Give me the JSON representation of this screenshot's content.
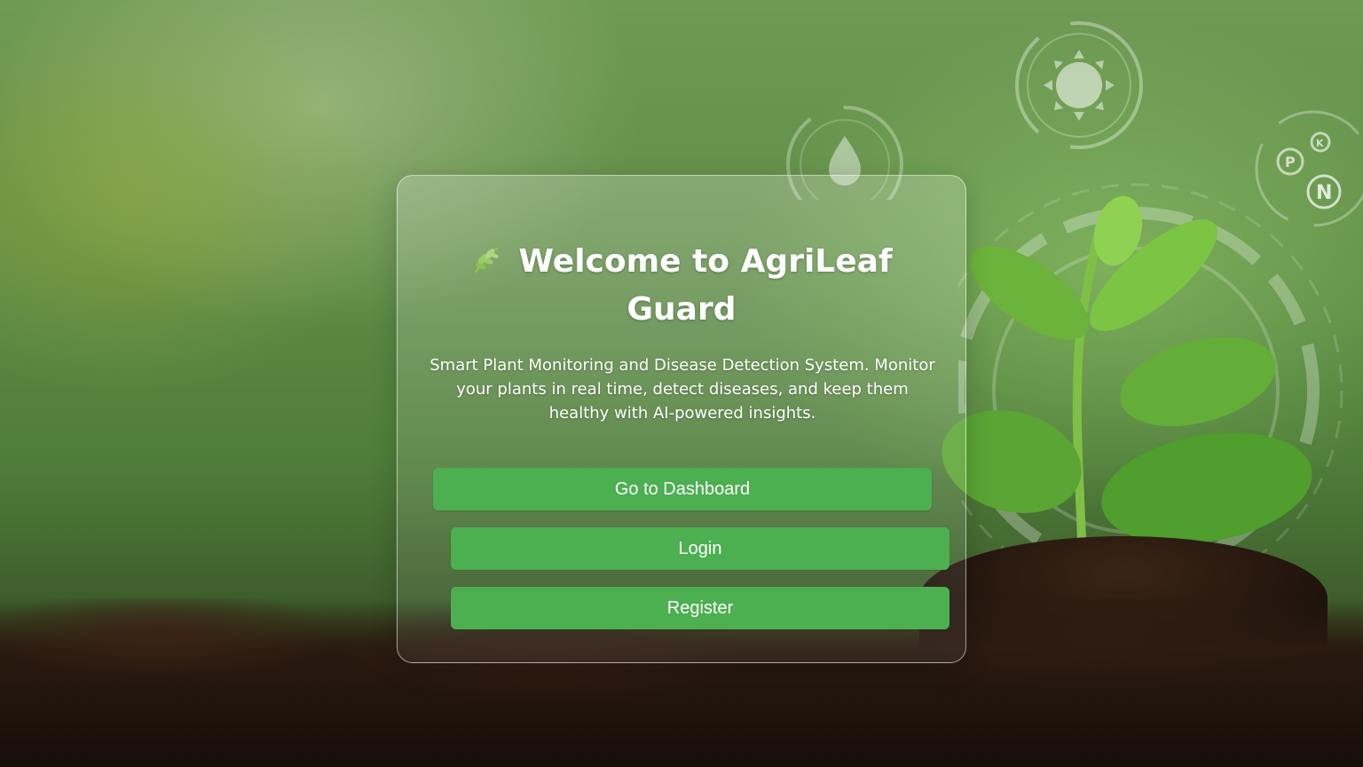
{
  "hero": {
    "title": "Welcome to AgriLeaf Guard",
    "title_icon": "herb-icon",
    "description": "Smart Plant Monitoring and Disease Detection System. Monitor your plants in real time, detect diseases, and keep them healthy with AI-powered insights."
  },
  "actions": {
    "dashboard_label": "Go to Dashboard",
    "login_label": "Login",
    "register_label": "Register"
  },
  "background": {
    "hud_icons": [
      "sun-icon",
      "water-drop-icon",
      "nutrient-pkn-icon"
    ]
  },
  "colors": {
    "button": "#4caf50",
    "text": "#ffffff"
  }
}
